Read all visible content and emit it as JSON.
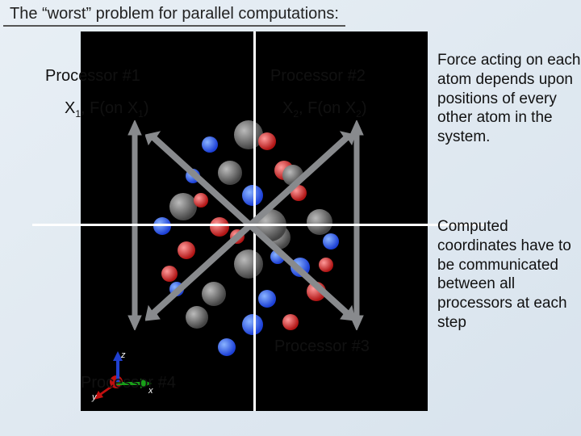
{
  "title": "The “worst” problem for parallel computations:",
  "processors": {
    "p1": "Processor #1",
    "p2": "Processor #2",
    "p3": "Processor #3",
    "p4": "Processor #4"
  },
  "xlabels": {
    "x1_a": "X",
    "x1_a_sub": "1",
    "x1_mid": ", F(on X",
    "x1_b_sub": "1",
    "x1_end": ")",
    "x2_a": "X",
    "x2_a_sub": "2",
    "x2_mid": ", F(on X",
    "x2_b_sub": "2",
    "x2_end": ")"
  },
  "right1": "Force acting on each atom depends upon positions of every other atom in the system.",
  "right2": "Computed coordinates have to be communicated between all processors at each step",
  "axes": {
    "x": "x",
    "y": "y",
    "z": "z"
  }
}
